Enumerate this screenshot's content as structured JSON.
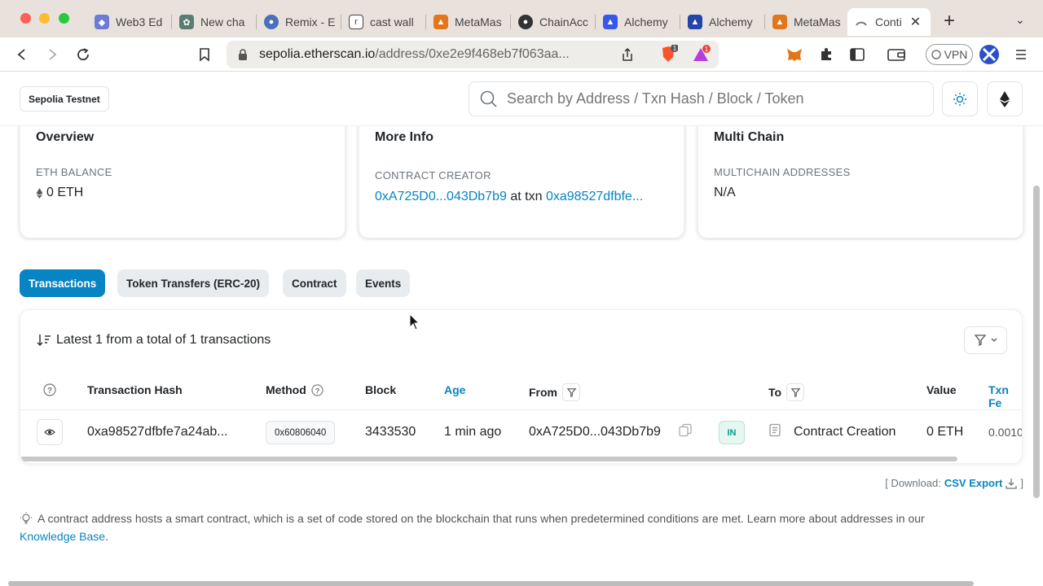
{
  "browser": {
    "tabs": [
      {
        "label": "Web3 Ed",
        "color": "#6c7bd6"
      },
      {
        "label": "New cha",
        "color": "#5a7d73"
      },
      {
        "label": "Remix - E",
        "color": "#4a6fbf"
      },
      {
        "label": "cast wall",
        "color": "#444444"
      },
      {
        "label": "MetaMas",
        "color": "#e2761b"
      },
      {
        "label": "ChainAcc",
        "color": "#333333"
      },
      {
        "label": "Alchemy",
        "color": "#3957e8"
      },
      {
        "label": "Alchemy",
        "color": "#2445a8"
      },
      {
        "label": "MetaMas",
        "color": "#e2761b"
      },
      {
        "label": "Conti",
        "color": "#888888"
      }
    ],
    "url_host": "sepolia.etherscan.io",
    "url_path": "/address/0xe2e9f468eb7f063aa...",
    "vpn_label": "VPN",
    "brave_badge": "1",
    "rewards_badge": "1"
  },
  "header": {
    "network": "Sepolia Testnet",
    "search_placeholder": "Search by Address / Txn Hash / Block / Token"
  },
  "overview": {
    "title": "Overview",
    "balance_label": "ETH BALANCE",
    "balance_value": "0 ETH"
  },
  "more_info": {
    "title": "More Info",
    "creator_label": "CONTRACT CREATOR",
    "creator_address": "0xA725D0...043Db7b9",
    "at_txn": "at txn",
    "creator_txn": "0xa98527dfbfe..."
  },
  "multichain": {
    "title": "Multi Chain",
    "label": "MULTICHAIN ADDRESSES",
    "value": "N/A"
  },
  "tabs": [
    "Transactions",
    "Token Transfers (ERC-20)",
    "Contract",
    "Events"
  ],
  "transactions": {
    "summary": "Latest 1 from a total of 1 transactions",
    "columns": {
      "hash": "Transaction Hash",
      "method": "Method",
      "block": "Block",
      "age": "Age",
      "from": "From",
      "to": "To",
      "value": "Value",
      "fee": "Txn Fe"
    },
    "rows": [
      {
        "hash": "0xa98527dfbfe7a24ab...",
        "method": "0x60806040",
        "block": "3433530",
        "age": "1 min ago",
        "from": "0xA725D0...043Db7b9",
        "direction": "IN",
        "to": "Contract Creation",
        "value": "0 ETH",
        "fee": "0.0010"
      }
    ]
  },
  "download": {
    "prefix": "[ Download:",
    "link": "CSV Export",
    "suffix": "]"
  },
  "note": {
    "text": "A contract address hosts a smart contract, which is a set of code stored on the blockchain that runs when predetermined conditions are met. Learn more about addresses in our",
    "link": "Knowledge Base",
    "end": "."
  }
}
